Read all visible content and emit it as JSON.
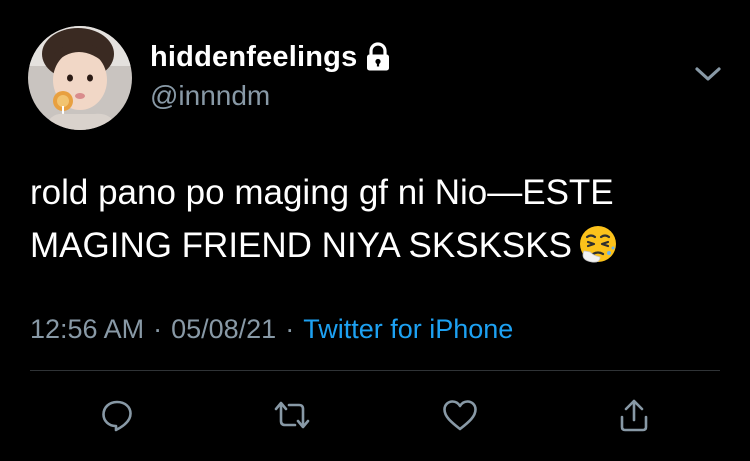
{
  "user": {
    "display_name": "hiddenfeelings",
    "handle": "@innndm",
    "protected_icon": "lock-icon",
    "avatar": "profile-photo"
  },
  "tweet": {
    "line1": "rold pano po maging gf ni Nio—ESTE",
    "line2": "MAGING FRIEND NIYA SKSKSKS",
    "emoji": "sneezing-face-emoji"
  },
  "meta": {
    "time": "12:56 AM",
    "separator1": "·",
    "date": "05/08/21",
    "separator2": "·",
    "source": "Twitter for iPhone"
  },
  "actions": {
    "reply_icon": "reply-icon",
    "retweet_icon": "retweet-icon",
    "like_icon": "heart-icon",
    "share_icon": "share-icon",
    "more_icon": "chevron-down-icon"
  },
  "colors": {
    "background": "#000000",
    "text": "#ffffff",
    "secondary": "#8899a6",
    "link": "#1da1f2",
    "divider": "#2f3336"
  }
}
